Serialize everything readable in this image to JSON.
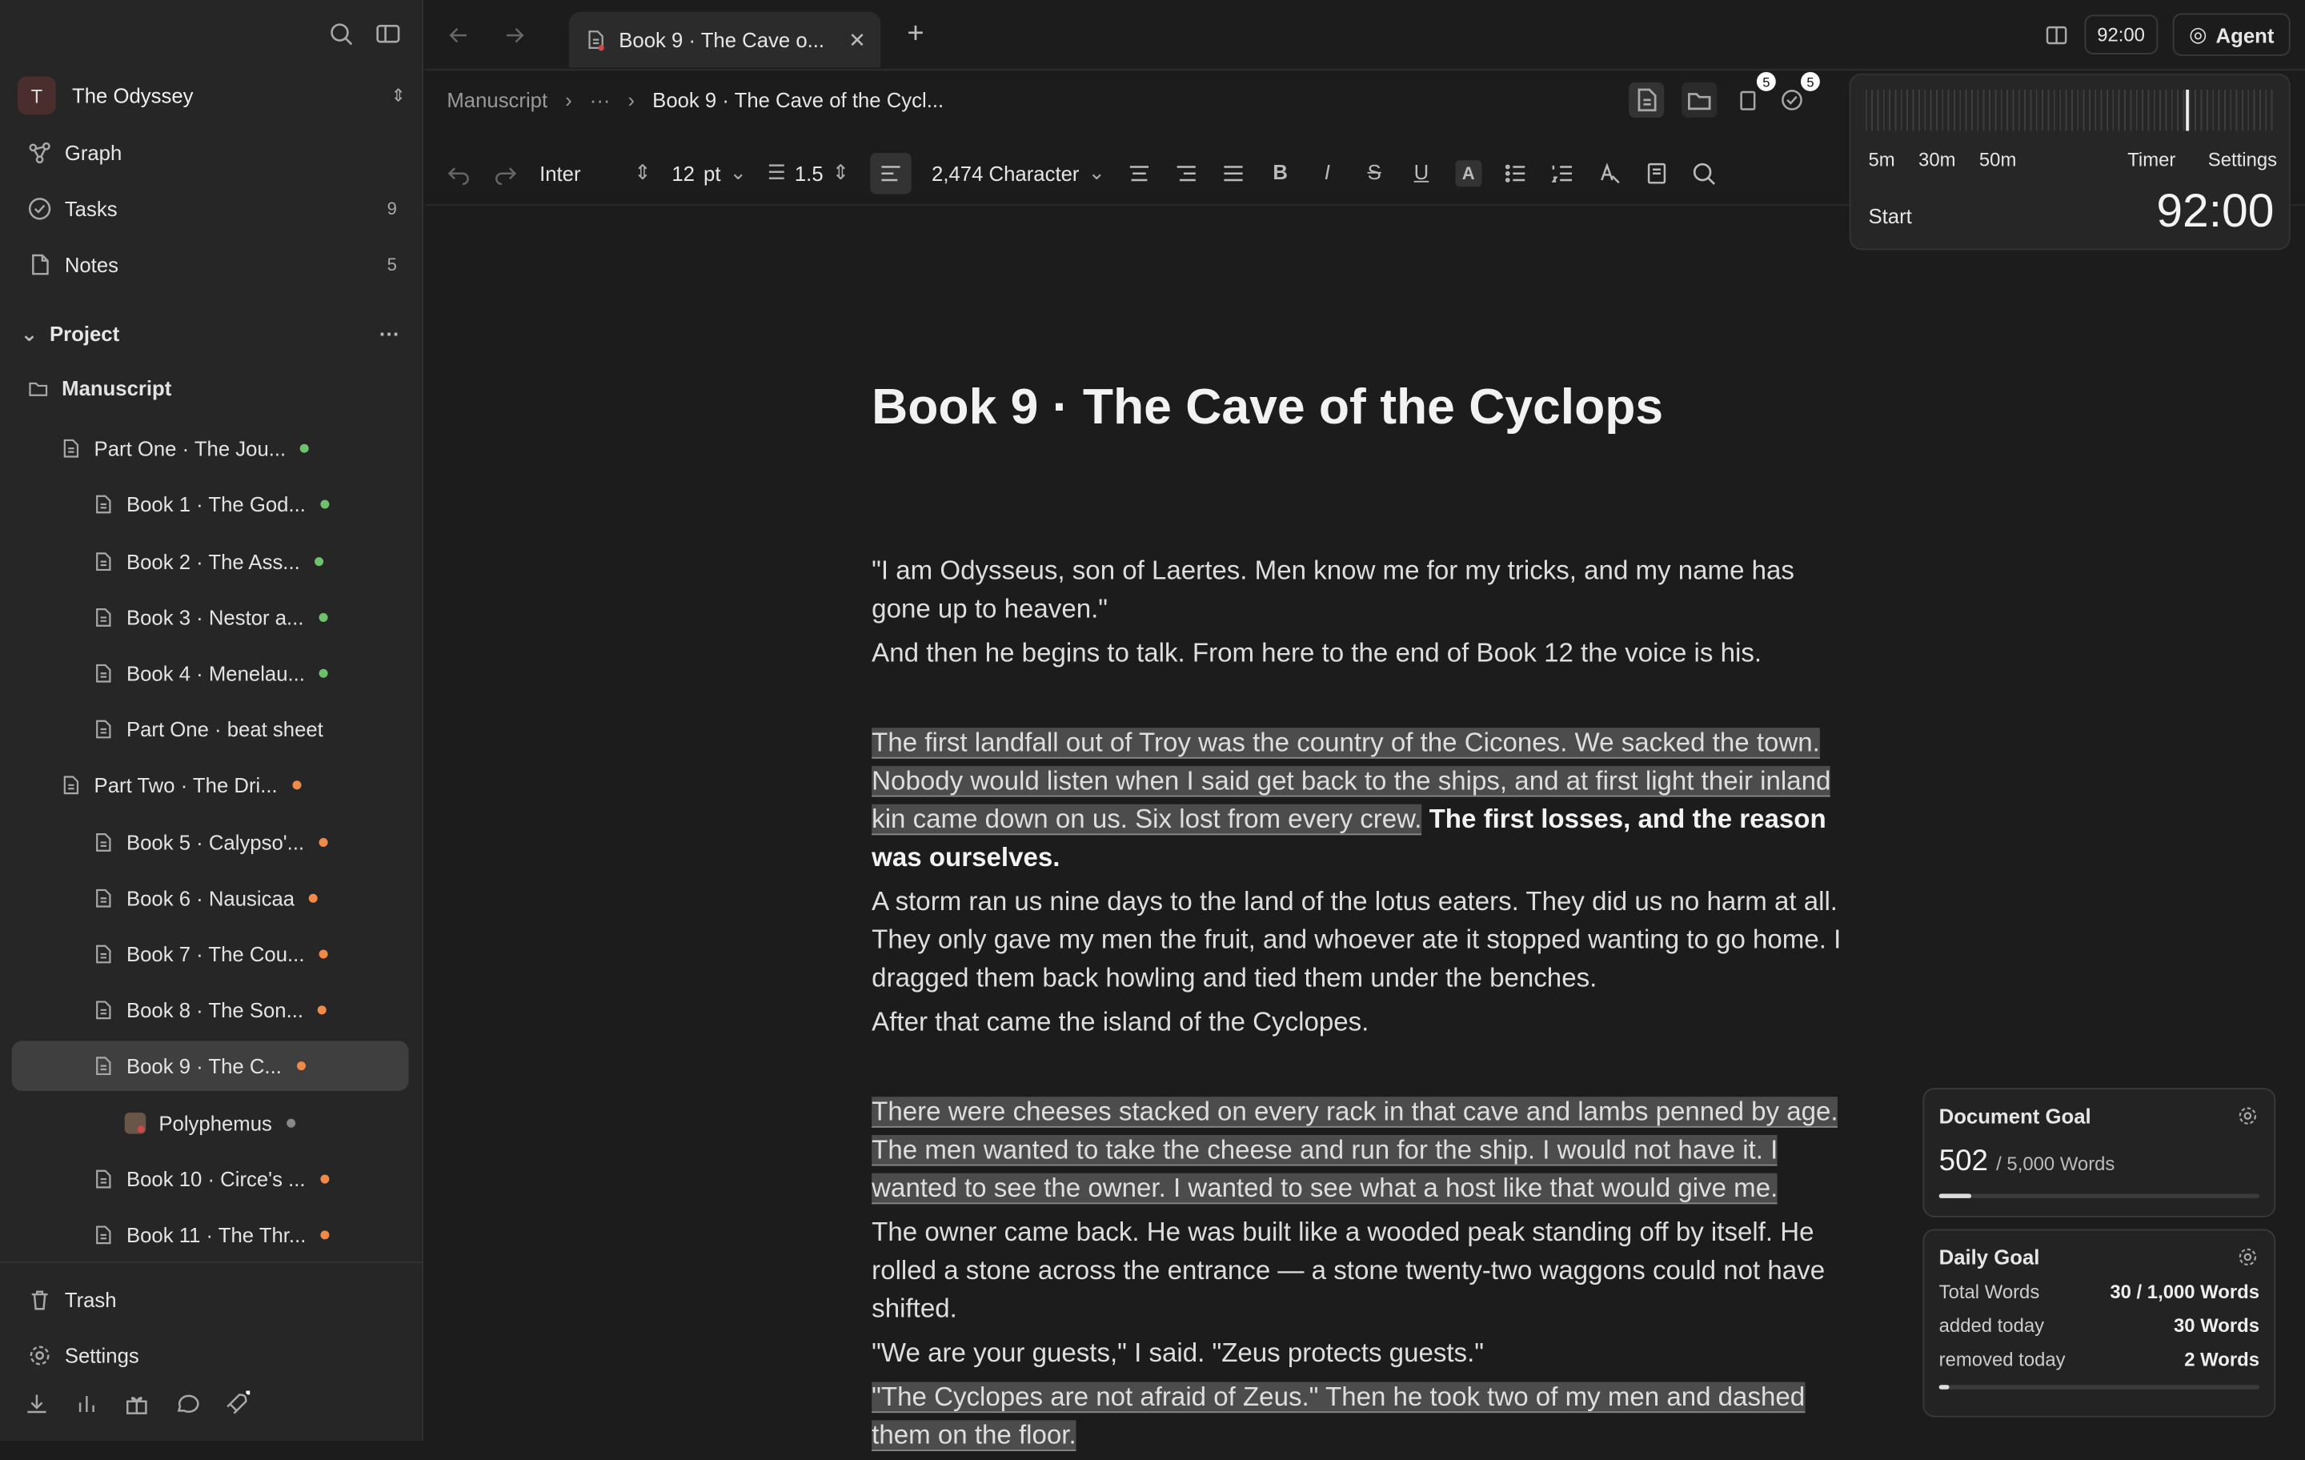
{
  "sidebar": {
    "project_avatar": "T",
    "project_name": "The Odyssey",
    "nav": [
      {
        "label": "Graph",
        "count": ""
      },
      {
        "label": "Tasks",
        "count": "9"
      },
      {
        "label": "Notes",
        "count": "5"
      }
    ],
    "section_label": "Project",
    "tree": [
      {
        "label": "Manuscript",
        "level": 0,
        "dot": ""
      },
      {
        "label": "Part One · The Jou...",
        "level": 1,
        "dot": "#6ec26e"
      },
      {
        "label": "Book 1 · The God...",
        "level": 2,
        "dot": "#6ec26e"
      },
      {
        "label": "Book 2 · The Ass...",
        "level": 2,
        "dot": "#6ec26e"
      },
      {
        "label": "Book 3 · Nestor a...",
        "level": 2,
        "dot": "#6ec26e"
      },
      {
        "label": "Book 4 · Menelau...",
        "level": 2,
        "dot": "#6ec26e"
      },
      {
        "label": "Part One · beat sheet",
        "level": 2,
        "dot": ""
      },
      {
        "label": "Part Two · The Dri...",
        "level": 1,
        "dot": "#f08a4b"
      },
      {
        "label": "Book 5 · Calypso'...",
        "level": 2,
        "dot": "#f08a4b"
      },
      {
        "label": "Book 6 · Nausicaa",
        "level": 2,
        "dot": "#f08a4b"
      },
      {
        "label": "Book 7 · The Cou...",
        "level": 2,
        "dot": "#f08a4b"
      },
      {
        "label": "Book 8 · The Son...",
        "level": 2,
        "dot": "#f08a4b"
      },
      {
        "label": "Book 9 · The C...",
        "level": 2,
        "dot": "#f08a4b",
        "selected": true
      },
      {
        "label": "Polyphemus",
        "level": 3,
        "dot": "#888888"
      },
      {
        "label": "Book 10 · Circe's ...",
        "level": 2,
        "dot": "#f08a4b"
      },
      {
        "label": "Book 11 · The Thr...",
        "level": 2,
        "dot": "#f08a4b"
      }
    ],
    "trash": "Trash",
    "settings": "Settings"
  },
  "tab": {
    "title": "Book 9 · The Cave o..."
  },
  "topbar": {
    "timer": "92:00",
    "agent": "Agent"
  },
  "breadcrumb": {
    "root": "Manuscript",
    "ellipsis": "···",
    "current": "Book 9 · The Cave of the Cycl..."
  },
  "badges": {
    "docs": "5",
    "tasks": "5"
  },
  "toolbar": {
    "font": "Inter",
    "size": "12",
    "unit": "pt",
    "line_height": "1.5",
    "count": "2,474 Character"
  },
  "timer_panel": {
    "presets": [
      "5m",
      "30m",
      "50m"
    ],
    "timer_tab": "Timer",
    "settings_tab": "Settings",
    "start": "Start",
    "time": "92:00",
    "progress_fraction": 0.78
  },
  "document": {
    "title": "Book 9 · The Cave of the Cyclops",
    "p1": "\"I am Odysseus, son of Laertes. Men know me for my tricks, and my name has gone up to heaven.\"",
    "p2": "And then he begins to talk. From here to the end of Book 12 the voice is his.",
    "p3_hl": "The first landfall out of Troy was the country of the Cicones. We sacked the town. Nobody would listen when I said get back to the ships, and at first light their inland kin came down on us. Six lost from every crew.",
    "p3_bold": "The first losses, and the reason was ourselves.",
    "p4": "A storm ran us nine days to the land of the lotus eaters. They did us no harm at all. They only gave my men the fruit, and whoever ate it stopped wanting to go home. I dragged them back howling and tied them under the benches.",
    "p5": "After that came the island of the Cyclopes.",
    "p6_hl": "There were cheeses stacked on every rack in that cave and lambs penned by age. The men wanted to take the cheese and run for the ship. I would not have it. I wanted to see the owner. I wanted to see what a host like that would give me.",
    "p7": "The owner came back. He was built like a wooded peak standing off by itself. He rolled a stone across the entrance — a stone twenty-two waggons could not have shifted.",
    "p8": "\"We are your guests,\" I said. \"Zeus protects guests.\"",
    "p9_hl": "\"The Cyclopes are not afraid of Zeus.\" Then he took two of my men and dashed them on the floor."
  },
  "doc_goal": {
    "title": "Document Goal",
    "value": "502",
    "target": "/ 5,000 Words",
    "fraction": 0.1
  },
  "daily_goal": {
    "title": "Daily Goal",
    "rows": [
      {
        "label": "Total Words",
        "value": "30 / 1,000 Words"
      },
      {
        "label": "added today",
        "value": "30 Words"
      },
      {
        "label": "removed today",
        "value": "2 Words"
      }
    ],
    "fraction": 0.03
  }
}
